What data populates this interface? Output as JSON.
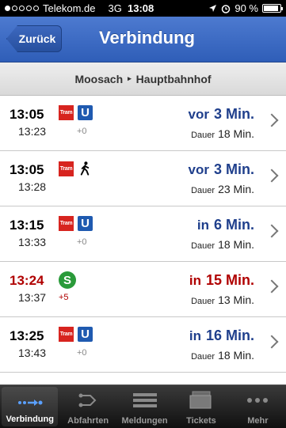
{
  "status_bar": {
    "carrier": "Telekom.de",
    "network": "3G",
    "time": "13:08",
    "battery": "90 %",
    "battery_level": 0.9
  },
  "nav": {
    "back_label": "Zurück",
    "title": "Verbindung"
  },
  "route": {
    "from": "Moosach",
    "separator": "▸",
    "to": "Hauptbahnhof"
  },
  "connections": [
    {
      "departure": "13:05",
      "arrival": "13:23",
      "modes": [
        "tram",
        "ubahn"
      ],
      "tram_label": "Tram",
      "ubahn_label": "U",
      "delay": "+0",
      "rel_prefix": "vor",
      "rel_value": "3 Min.",
      "duration_label": "Dauer",
      "duration": "18 Min.",
      "late": false
    },
    {
      "departure": "13:05",
      "arrival": "13:28",
      "modes": [
        "tram",
        "walk"
      ],
      "tram_label": "Tram",
      "delay": "",
      "rel_prefix": "vor",
      "rel_value": "3 Min.",
      "duration_label": "Dauer",
      "duration": "23 Min.",
      "late": false
    },
    {
      "departure": "13:15",
      "arrival": "13:33",
      "modes": [
        "tram",
        "ubahn"
      ],
      "tram_label": "Tram",
      "ubahn_label": "U",
      "delay": "+0",
      "rel_prefix": "in",
      "rel_value": "6 Min.",
      "duration_label": "Dauer",
      "duration": "18 Min.",
      "late": false
    },
    {
      "departure": "13:24",
      "arrival": "13:37",
      "modes": [
        "sbahn"
      ],
      "sbahn_label": "S",
      "delay": "+5",
      "rel_prefix": "in",
      "rel_value": "15 Min.",
      "duration_label": "Dauer",
      "duration": "13 Min.",
      "late": true
    },
    {
      "departure": "13:25",
      "arrival": "13:43",
      "modes": [
        "tram",
        "ubahn"
      ],
      "tram_label": "Tram",
      "ubahn_label": "U",
      "delay": "+0",
      "rel_prefix": "in",
      "rel_value": "16 Min.",
      "duration_label": "Dauer",
      "duration": "18 Min.",
      "late": false
    }
  ],
  "tabs": [
    {
      "label": "Verbindung",
      "icon": "connection-icon",
      "active": true
    },
    {
      "label": "Abfahrten",
      "icon": "departures-icon",
      "active": false
    },
    {
      "label": "Meldungen",
      "icon": "list-icon",
      "active": false
    },
    {
      "label": "Tickets",
      "icon": "tickets-icon",
      "active": false
    },
    {
      "label": "Mehr",
      "icon": "more-icon",
      "active": false
    }
  ],
  "colors": {
    "nav_blue": "#2f5eb8",
    "tram_red": "#d7241f",
    "ubahn_blue": "#1f5ab0",
    "sbahn_green": "#2a9a3a",
    "late_red": "#b00000",
    "rel_blue": "#1f3f8c"
  }
}
